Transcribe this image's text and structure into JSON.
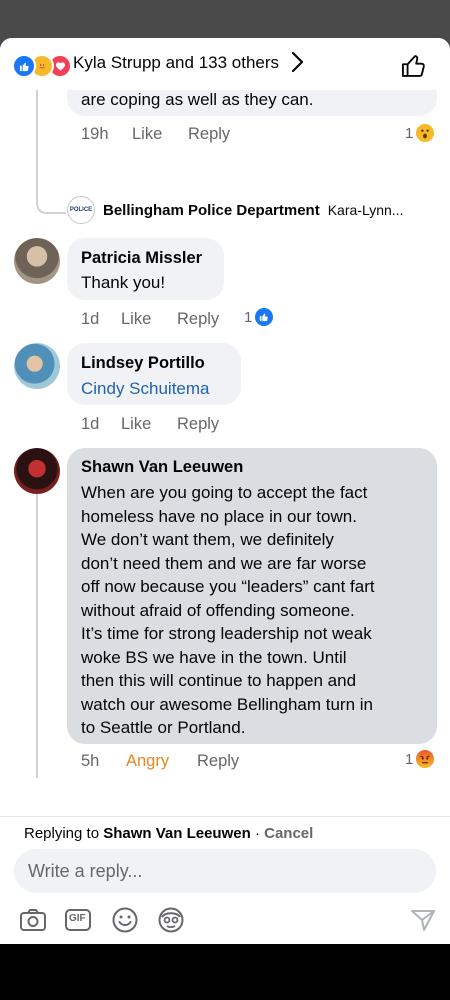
{
  "reactions_header": {
    "text": "Kyla Strupp and 133 others",
    "icons": [
      "like-icon",
      "care-icon",
      "love-icon"
    ]
  },
  "partial_comment": {
    "text": "are coping as well as they can.",
    "time": "19h",
    "like": "Like",
    "reply": "Reply",
    "reaction_count": "1",
    "reaction_icon": "wow-icon"
  },
  "reply_preview": {
    "name": "Bellingham Police Department",
    "preview": "Kara-Lynn...",
    "badge_text": "POLICE"
  },
  "comments": [
    {
      "name": "Patricia Missler",
      "text": "Thank you!",
      "time": "1d",
      "like": "Like",
      "reply": "Reply",
      "reaction_count": "1",
      "reaction_icon": "like-icon"
    },
    {
      "name": "Lindsey Portillo",
      "text": "Cindy Schuitema",
      "time": "1d",
      "like": "Like",
      "reply": "Reply"
    },
    {
      "name": "Shawn Van Leeuwen",
      "lines": [
        "When are you going to accept the fact",
        "homeless have no place in our town.",
        "We don’t want them, we definitely",
        "don’t need them and we are far worse",
        "off now because you “leaders” cant fart",
        "without afraid of offending someone.",
        "It’s time for strong leadership not weak",
        "woke BS we have in the town.  Until",
        "then this will continue to happen and",
        "watch our awesome Bellingham turn in",
        "to Seattle or Portland."
      ],
      "time": "5h",
      "reaction_label": "Angry",
      "reply": "Reply",
      "reaction_count": "1",
      "reaction_icon": "angry-icon"
    }
  ],
  "composer": {
    "replying_prefix": "Replying to",
    "replying_name": "Shawn Van Leeuwen",
    "separator": "·",
    "cancel": "Cancel",
    "placeholder": "Write a reply...",
    "tools": [
      "camera-icon",
      "gif-icon",
      "emoji-icon",
      "avatar-sticker-icon",
      "send-icon"
    ],
    "gif_label": "GIF"
  }
}
